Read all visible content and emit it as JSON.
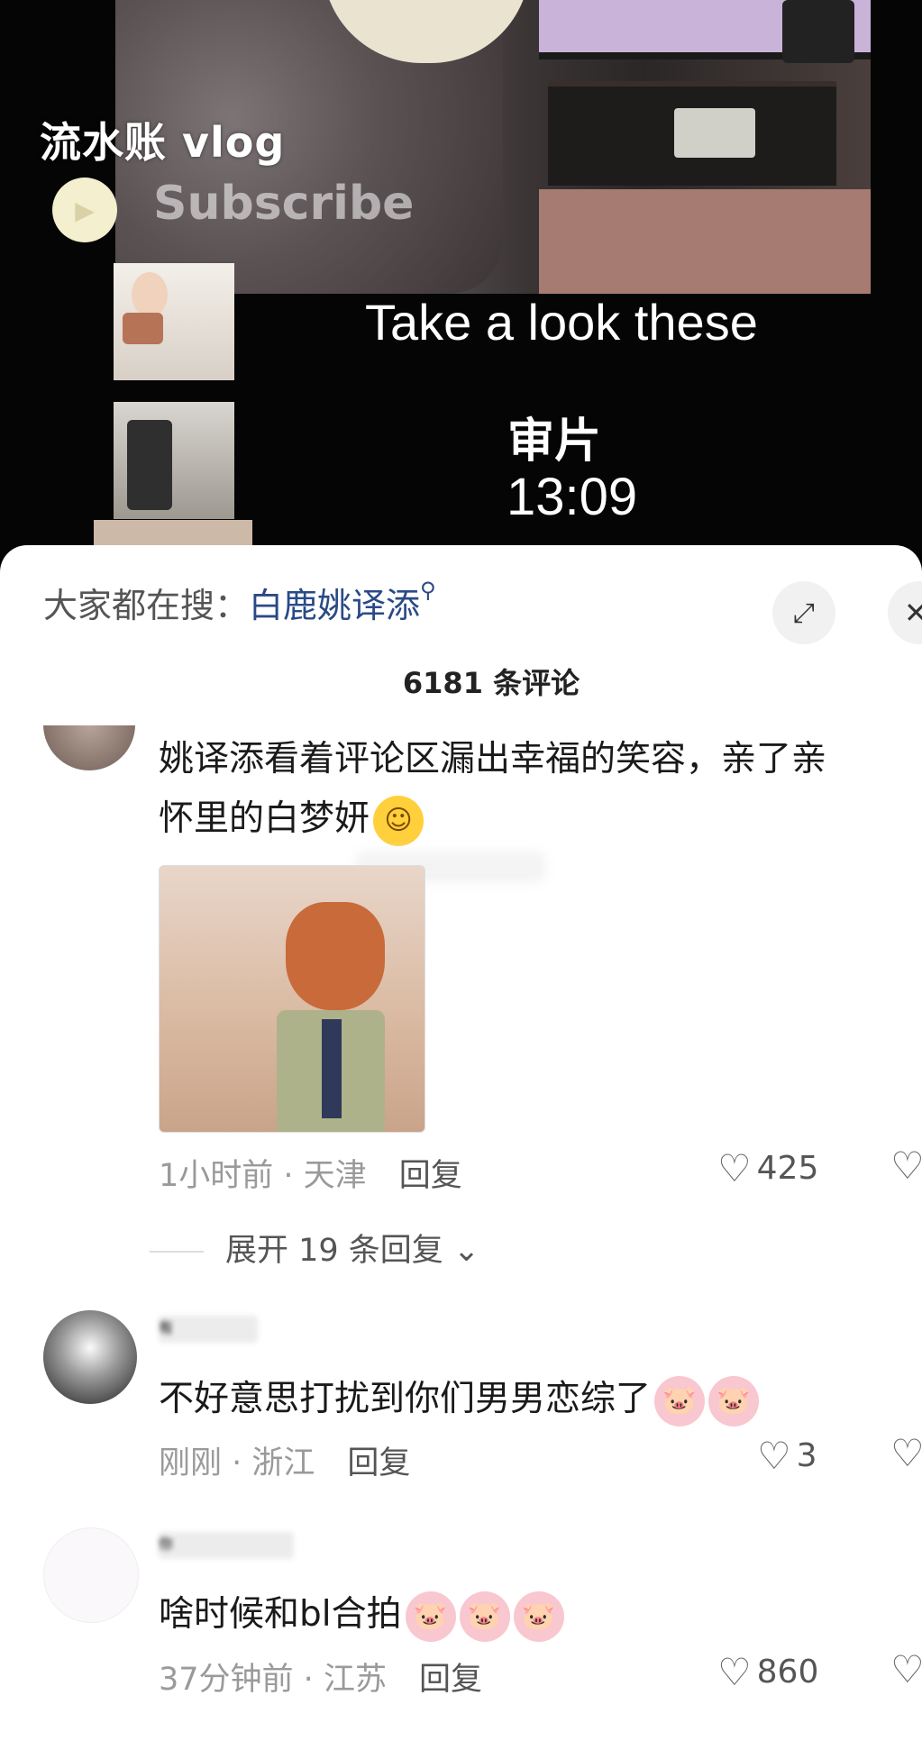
{
  "video": {
    "title": "流水账 vlog",
    "subscribe": "Subscribe",
    "caption": "Take a look these",
    "segment_label": "审片",
    "segment_time": "13:09"
  },
  "search": {
    "prefix": "大家都在搜：",
    "keyword": "白鹿姚译添"
  },
  "comments_count": "6181 条评论",
  "comments": [
    {
      "text_line1": "姚译添看着评论区漏出幸福的笑容，亲了亲",
      "text_line2": "怀里的白梦妍",
      "time": "1小时前",
      "location": "天津",
      "reply": "回复",
      "likes": "425"
    },
    {
      "name": "有",
      "text": "不好意思打扰到你们男男恋综了",
      "time": "刚刚",
      "location": "浙江",
      "reply": "回复",
      "likes": "3"
    },
    {
      "name": "你",
      "text": "啥时候和bl合拍",
      "time": "37分钟前",
      "location": "江苏",
      "reply": "回复",
      "likes": "860"
    }
  ],
  "expand_replies": "展开 19 条回复",
  "icons": {
    "heart": "heart-icon",
    "dislike": "dislike-icon",
    "expand": "expand-icon",
    "close": "close-icon",
    "search": "search-icon",
    "chevron": "chevron-down-icon"
  },
  "colors": {
    "keyword": "#2a4a86",
    "meta": "#9a9a9a"
  }
}
